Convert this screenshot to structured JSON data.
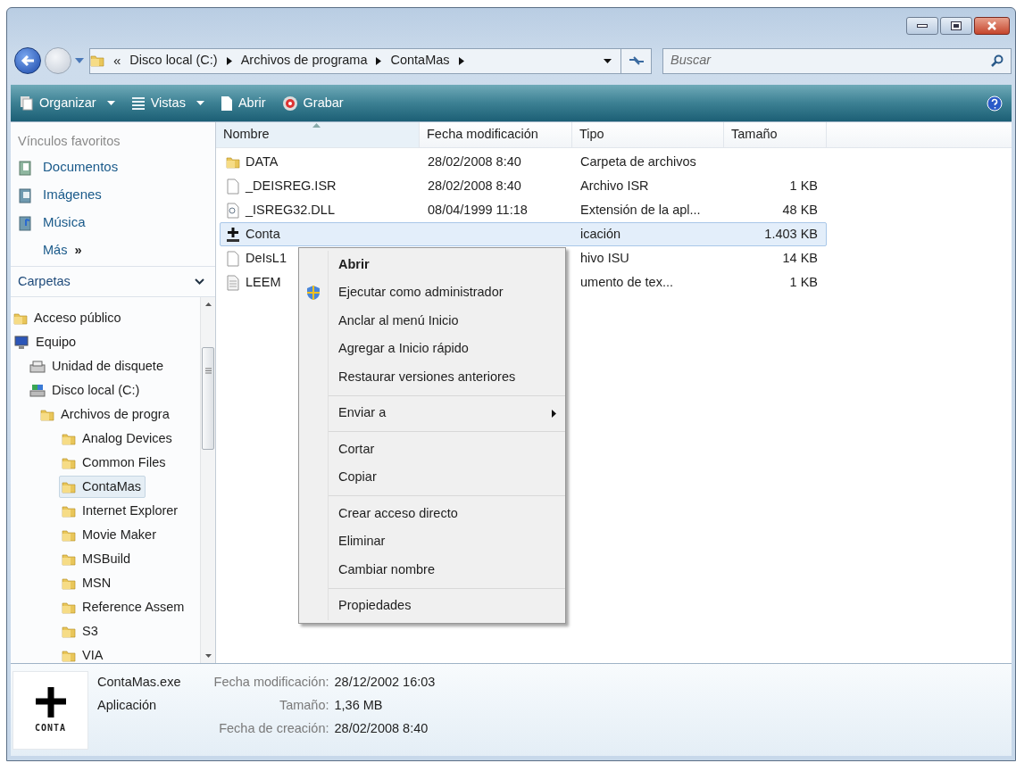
{
  "address_bar": {
    "overflow": "«",
    "segments": [
      "Disco local (C:)",
      "Archivos de programa",
      "ContaMas"
    ]
  },
  "search": {
    "placeholder": "Buscar"
  },
  "toolbar": [
    {
      "kind": "organize",
      "label": "Organizar",
      "dropdown": true
    },
    {
      "kind": "views",
      "label": "Vistas",
      "dropdown": true
    },
    {
      "kind": "open",
      "label": "Abrir",
      "dropdown": false
    },
    {
      "kind": "burn",
      "label": "Grabar",
      "dropdown": false
    }
  ],
  "favorites": {
    "title": "Vínculos favoritos",
    "items": [
      {
        "kind": "documents",
        "label": "Documentos"
      },
      {
        "kind": "pictures",
        "label": "Imágenes"
      },
      {
        "kind": "music",
        "label": "Música"
      }
    ],
    "more": {
      "label": "Más",
      "arrow": "»"
    }
  },
  "folders": {
    "title": "Carpetas",
    "tree": [
      {
        "kind": "folder",
        "label": "Acceso público",
        "selected": false
      },
      {
        "kind": "computer",
        "label": "Equipo",
        "selected": false,
        "children": [
          {
            "kind": "floppy",
            "label": "Unidad de disquete",
            "selected": false
          },
          {
            "kind": "drive",
            "label": "Disco local (C:)",
            "selected": false,
            "children": [
              {
                "kind": "folder",
                "label": "Archivos de progra",
                "selected": false,
                "children": [
                  {
                    "kind": "folder",
                    "label": "Analog Devices",
                    "selected": false
                  },
                  {
                    "kind": "folder",
                    "label": "Common Files",
                    "selected": false
                  },
                  {
                    "kind": "folder",
                    "label": "ContaMas",
                    "selected": true
                  },
                  {
                    "kind": "folder",
                    "label": "Internet Explorer",
                    "selected": false
                  },
                  {
                    "kind": "folder",
                    "label": "Movie Maker",
                    "selected": false
                  },
                  {
                    "kind": "folder",
                    "label": "MSBuild",
                    "selected": false
                  },
                  {
                    "kind": "folder",
                    "label": "MSN",
                    "selected": false
                  },
                  {
                    "kind": "folder",
                    "label": "Reference Assem",
                    "selected": false
                  },
                  {
                    "kind": "folder",
                    "label": "S3",
                    "selected": false
                  },
                  {
                    "kind": "folder",
                    "label": "VIA",
                    "selected": false
                  }
                ]
              }
            ]
          }
        ]
      }
    ]
  },
  "table": {
    "columns": [
      "Nombre",
      "Fecha modificación",
      "Tipo",
      "Tamaño"
    ],
    "rows": [
      {
        "kind": "folder",
        "selected": false,
        "name": "DATA",
        "date": "28/02/2008 8:40",
        "type": "Carpeta de archivos"
      },
      {
        "kind": "file",
        "selected": false,
        "name": "_DEISREG.ISR",
        "date": "28/02/2008 8:40",
        "type": "Archivo ISR",
        "size": "1 KB"
      },
      {
        "kind": "dll",
        "selected": false,
        "name": "_ISREG32.DLL",
        "date": "08/04/1999 11:18",
        "type": "Extensión de la apl...",
        "size": "48 KB"
      },
      {
        "kind": "app",
        "selected": true,
        "name": "Conta",
        "type": "icación",
        "size": "1.403 KB"
      },
      {
        "kind": "file",
        "selected": false,
        "name": "DeIsL1",
        "type": "hivo ISU",
        "size": "14 KB"
      },
      {
        "kind": "text",
        "selected": false,
        "name": "LEEM",
        "type": "umento de tex...",
        "size": "1 KB"
      }
    ]
  },
  "context_menu": {
    "groups": [
      [
        {
          "label": "Abrir",
          "default": true
        },
        {
          "label": "Ejecutar como administrador",
          "shield": true
        },
        {
          "label": "Anclar al menú Inicio"
        },
        {
          "label": "Agregar a Inicio rápido"
        },
        {
          "label": "Restaurar versiones anteriores"
        }
      ],
      [
        {
          "label": "Enviar a",
          "submenu": true
        }
      ],
      [
        {
          "label": "Cortar"
        },
        {
          "label": "Copiar"
        }
      ],
      [
        {
          "label": "Crear acceso directo"
        },
        {
          "label": "Eliminar"
        },
        {
          "label": "Cambiar nombre"
        }
      ],
      [
        {
          "label": "Propiedades"
        }
      ]
    ]
  },
  "details": {
    "icon_label": "CONTA",
    "name": "ContaMas.exe",
    "type": "Aplicación",
    "properties": [
      {
        "label": "Fecha modificación:",
        "value": "28/12/2002 16:03"
      },
      {
        "label": "Tamaño:",
        "value": "1,36 MB"
      },
      {
        "label": "Fecha de creación:",
        "value": "28/02/2008 8:40"
      }
    ]
  }
}
